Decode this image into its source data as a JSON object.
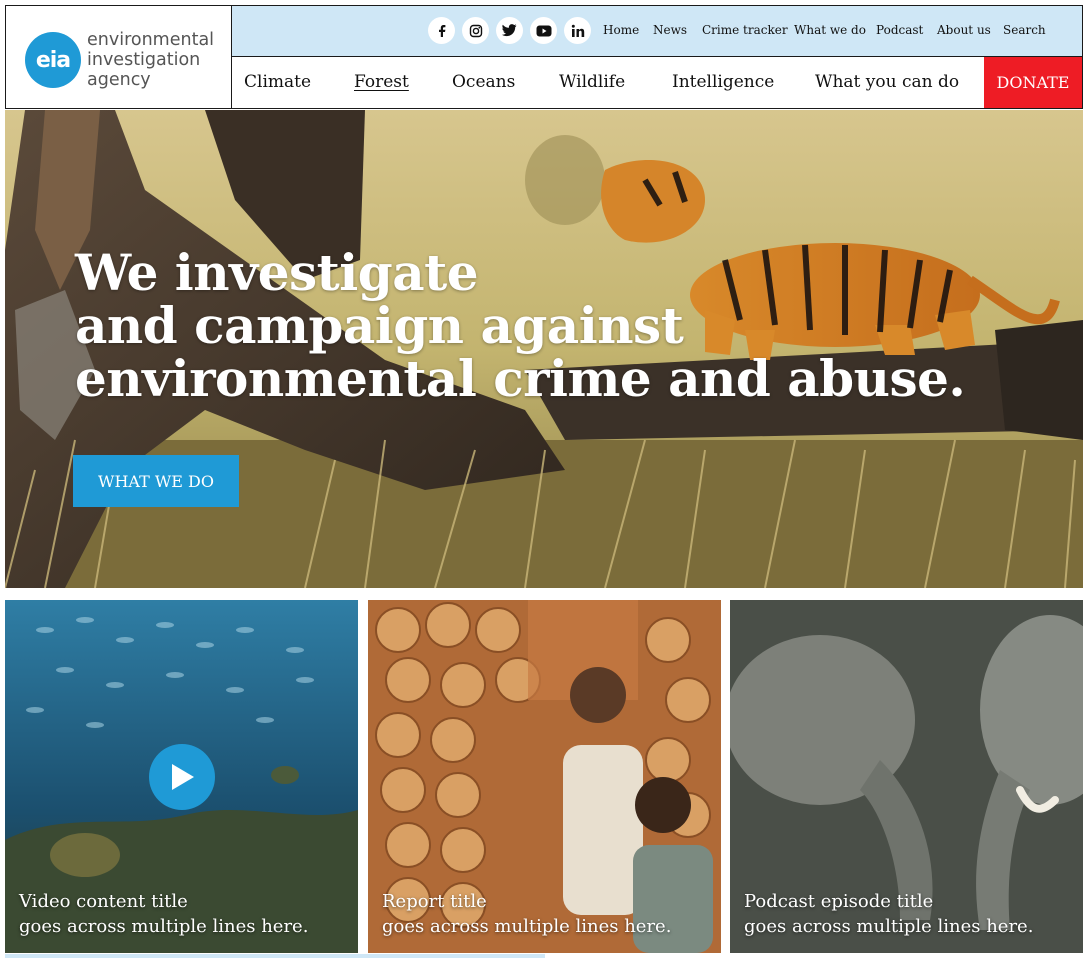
{
  "logo": {
    "mark": "eia",
    "lines": [
      "environmental",
      "investigation",
      "agency"
    ]
  },
  "social": [
    {
      "name": "facebook-icon",
      "glyph": "f"
    },
    {
      "name": "instagram-icon",
      "glyph": "ig"
    },
    {
      "name": "twitter-icon",
      "glyph": "tw"
    },
    {
      "name": "youtube-icon",
      "glyph": "yt"
    },
    {
      "name": "linkedin-icon",
      "glyph": "in"
    }
  ],
  "utility_nav": [
    "Home",
    "News",
    "Crime tracker",
    "What we do",
    "Podcast",
    "About us",
    "Search"
  ],
  "main_nav": [
    "Climate",
    "Forest",
    "Oceans",
    "Wildlife",
    "Intelligence",
    "What you can do"
  ],
  "main_nav_active": "Forest",
  "donate_label": "DONATE",
  "hero": {
    "headline_lines": [
      "We investigate",
      "and campaign against",
      "environmental crime and abuse."
    ],
    "cta_label": "WHAT WE DO"
  },
  "cards": [
    {
      "type": "video",
      "title_lines": [
        "Video content title",
        "goes across multiple lines here."
      ]
    },
    {
      "type": "report",
      "title_lines": [
        "Report title",
        "goes across multiple lines here."
      ]
    },
    {
      "type": "podcast",
      "title_lines": [
        "Podcast episode title",
        "goes across multiple lines here."
      ]
    }
  ],
  "colors": {
    "brand_blue": "#1f9ad6",
    "strip_blue": "#cfe7f6",
    "donate_red": "#ee1c25"
  }
}
